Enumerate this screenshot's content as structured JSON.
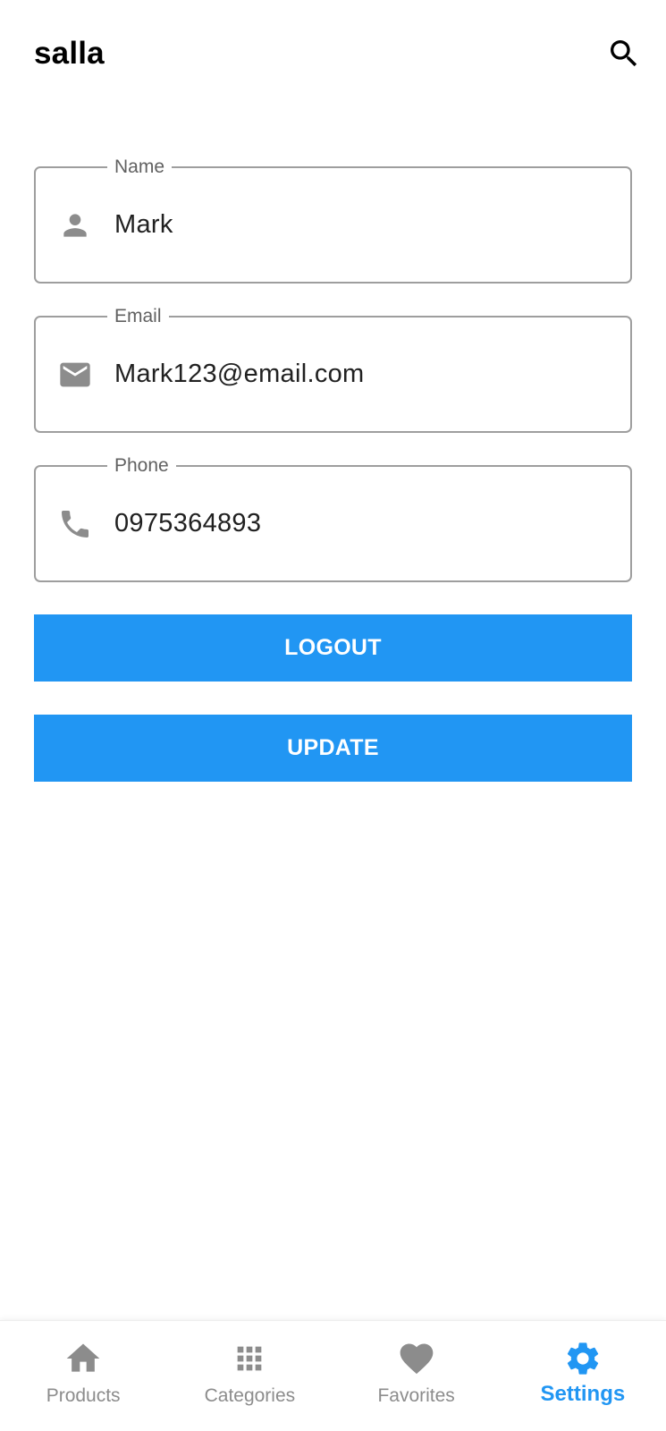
{
  "app_bar": {
    "title": "salla",
    "search_icon": "search-icon"
  },
  "form": {
    "name": {
      "label": "Name",
      "value": "Mark",
      "icon": "person-icon"
    },
    "email": {
      "label": "Email",
      "value": "Mark123@email.com",
      "icon": "mail-icon"
    },
    "phone": {
      "label": "Phone",
      "value": "0975364893",
      "icon": "phone-icon"
    }
  },
  "buttons": {
    "logout": "LOGOUT",
    "update": "UPDATE"
  },
  "bottom_nav": {
    "items": [
      {
        "label": "Products",
        "icon": "home-icon",
        "active": false
      },
      {
        "label": "Categories",
        "icon": "apps-grid-icon",
        "active": false
      },
      {
        "label": "Favorites",
        "icon": "heart-icon",
        "active": false
      },
      {
        "label": "Settings",
        "icon": "gear-icon",
        "active": true
      }
    ]
  },
  "colors": {
    "accent": "#2196f3",
    "field_border": "#9e9e9e",
    "icon_gray": "#8c8c8c"
  }
}
